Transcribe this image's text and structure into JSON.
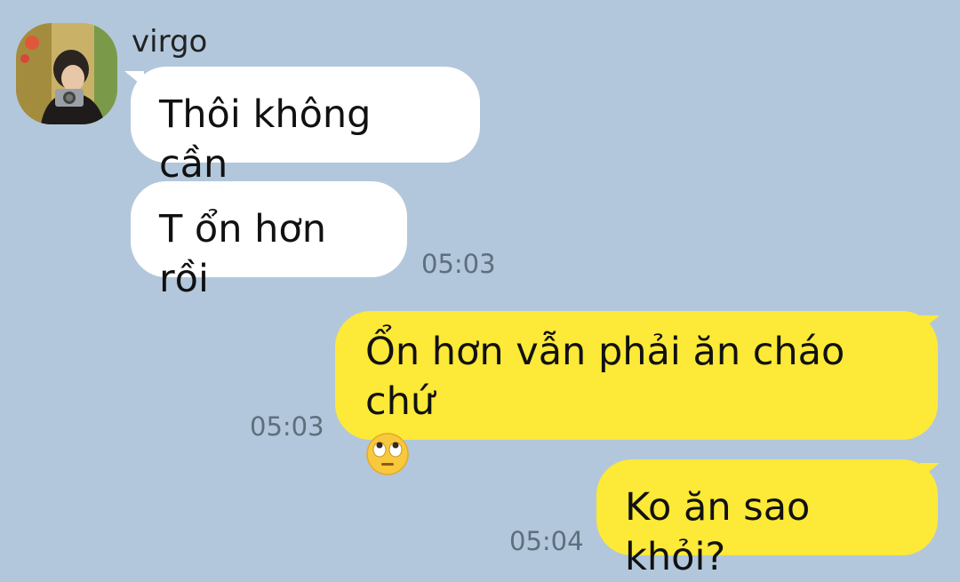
{
  "chat": {
    "contact_name": "virgo",
    "messages": [
      {
        "direction": "in",
        "text": "Thôi không cần",
        "time": ""
      },
      {
        "direction": "in",
        "text": "T ổn hơn rồi",
        "time": "05:03"
      },
      {
        "direction": "out",
        "text": "Ổn hơn vẫn phải ăn cháo chứ",
        "emoji": "face-with-rolling-eyes",
        "time": "05:03"
      },
      {
        "direction": "out",
        "text": "Ko ăn sao khỏi?",
        "time": "05:04"
      }
    ]
  },
  "colors": {
    "background": "#b2c7db",
    "incoming_bubble": "#ffffff",
    "outgoing_bubble": "#fde937",
    "timestamp": "#5f6e7d"
  }
}
